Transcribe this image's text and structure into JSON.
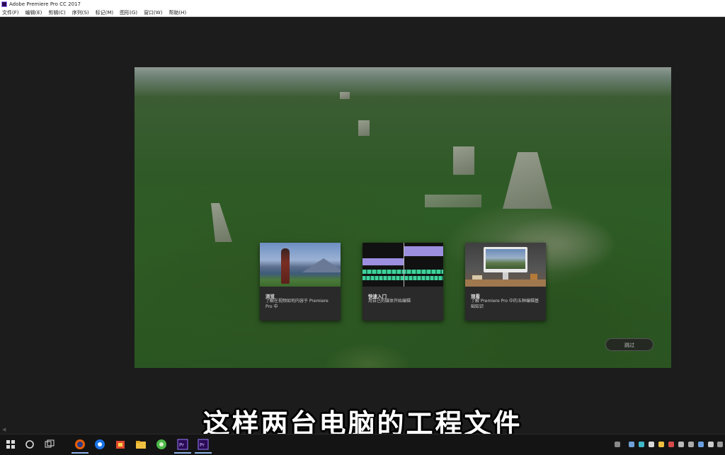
{
  "window": {
    "title": "Adobe Premiere Pro CC 2017"
  },
  "menu": {
    "items": [
      "文件(F)",
      "编辑(E)",
      "剪辑(C)",
      "序列(S)",
      "标记(M)",
      "图形(G)",
      "窗口(W)",
      "帮助(H)"
    ]
  },
  "welcome": {
    "cards": [
      {
        "title": "浏览",
        "desc": "了解在视频如何内容于 Premiere Pro 中"
      },
      {
        "title": "快速入门",
        "desc": "用自己的媒体开始编辑"
      },
      {
        "title": "观看",
        "desc": "了解 Premiere Pro 中的五种编辑基础知识"
      }
    ],
    "skip_label": "跳过"
  },
  "caption": {
    "text": "这样两台电脑的工程文件"
  },
  "taskbar": {
    "icons": [
      "windows-start-icon",
      "cortana-icon",
      "task-view-icon",
      "firefox-icon",
      "browser-icon",
      "app-icon",
      "file-explorer-icon",
      "green-app-icon",
      "premiere-pro-icon",
      "premiere-pro-icon"
    ],
    "accent": "#8fb4e8"
  },
  "colors": {
    "premiere_purple": "#2a0a54",
    "premiere_accent": "#9a7bff",
    "timeline_purple": "#9d8fe0",
    "timeline_green": "#3fd19a"
  }
}
